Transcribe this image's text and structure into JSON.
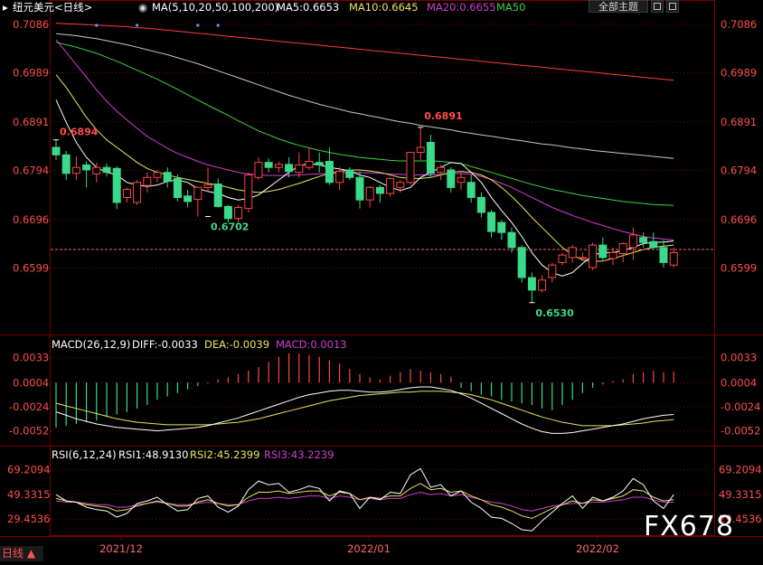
{
  "header": {
    "symbol": "纽元美元<日线>",
    "ma_title": "MA(5,10,20,50,100,200)",
    "ma5": "MA5:0.6653",
    "ma10": "MA10:0.6645",
    "ma20": "MA20:0.6655",
    "ma50": "MA50",
    "theme_button": "全部主题"
  },
  "colors": {
    "up": "#ff4545",
    "down": "#3bd98a",
    "ma5": "#ffffff",
    "ma10": "#e6e65a",
    "ma20": "#d23cd2",
    "ma50": "#3cd23c",
    "ma100": "#c8c8c8",
    "ma200": "#ff3c3c",
    "axis_text": "#ff4d4d",
    "grid": "#7a0000"
  },
  "price_axis_labels": [
    "0.7086",
    "0.6989",
    "0.6891",
    "0.6794",
    "0.6696",
    "0.6599"
  ],
  "annotations": {
    "high1": "0.6894",
    "low1": "0.6702",
    "high2": "0.6891",
    "low2": "0.6530"
  },
  "macd": {
    "title": "MACD(26,12,9)",
    "diff": "DIFF:-0.0033",
    "dea": "DEA:-0.0039",
    "macd": "MACD:0.0013",
    "axis_labels": [
      "0.0033",
      "0.0004",
      "-0.0024",
      "-0.0052"
    ]
  },
  "rsi": {
    "title": "RSI(6,12,24)",
    "rsi1": "RSI1:48.9130",
    "rsi2": "RSI2:45.2399",
    "rsi3": "RSI3:43.2239",
    "axis_labels": [
      "69.2094",
      "49.3315",
      "29.4536"
    ]
  },
  "x_labels": [
    "2021/12",
    "2022/01",
    "2022/02"
  ],
  "footer": {
    "timeframe": "日线 ▲",
    "watermark": "FX678"
  },
  "chart_data": {
    "type": "candlestick",
    "ylim": [
      0.647,
      0.71
    ],
    "current_price": 0.6636,
    "candles": [
      [
        0.684,
        0.6855,
        0.6815,
        0.6825
      ],
      [
        0.6825,
        0.6833,
        0.6775,
        0.6788
      ],
      [
        0.6788,
        0.6822,
        0.6775,
        0.68
      ],
      [
        0.6805,
        0.6812,
        0.676,
        0.6795
      ],
      [
        0.6787,
        0.681,
        0.677,
        0.68
      ],
      [
        0.68,
        0.6808,
        0.6782,
        0.679
      ],
      [
        0.6798,
        0.6802,
        0.6717,
        0.673
      ],
      [
        0.674,
        0.676,
        0.673,
        0.6756
      ],
      [
        0.673,
        0.6775,
        0.6725,
        0.677
      ],
      [
        0.6764,
        0.679,
        0.675,
        0.678
      ],
      [
        0.678,
        0.6795,
        0.677,
        0.679
      ],
      [
        0.679,
        0.68,
        0.676,
        0.6772
      ],
      [
        0.6778,
        0.6786,
        0.6732,
        0.674
      ],
      [
        0.6743,
        0.6755,
        0.672,
        0.6732
      ],
      [
        0.6736,
        0.6755,
        0.6702,
        0.676
      ],
      [
        0.676,
        0.68,
        0.675,
        0.6765
      ],
      [
        0.6767,
        0.6778,
        0.672,
        0.6722
      ],
      [
        0.6722,
        0.6725,
        0.669,
        0.6698
      ],
      [
        0.6698,
        0.6725,
        0.669,
        0.672
      ],
      [
        0.6718,
        0.679,
        0.671,
        0.6785
      ],
      [
        0.678,
        0.682,
        0.6775,
        0.681
      ],
      [
        0.681,
        0.6818,
        0.679,
        0.68
      ],
      [
        0.68,
        0.6812,
        0.679,
        0.6806
      ],
      [
        0.6806,
        0.682,
        0.678,
        0.6792
      ],
      [
        0.679,
        0.683,
        0.678,
        0.6805
      ],
      [
        0.68,
        0.684,
        0.6795,
        0.6812
      ],
      [
        0.681,
        0.683,
        0.679,
        0.6805
      ],
      [
        0.6812,
        0.684,
        0.6765,
        0.677
      ],
      [
        0.677,
        0.68,
        0.6755,
        0.6792
      ],
      [
        0.6795,
        0.68,
        0.6775,
        0.678
      ],
      [
        0.678,
        0.6792,
        0.6718,
        0.6735
      ],
      [
        0.6735,
        0.6763,
        0.672,
        0.676
      ],
      [
        0.676,
        0.6765,
        0.673,
        0.6748
      ],
      [
        0.6748,
        0.678,
        0.6742,
        0.6778
      ],
      [
        0.676,
        0.6775,
        0.675,
        0.677
      ],
      [
        0.677,
        0.683,
        0.6765,
        0.683
      ],
      [
        0.683,
        0.688,
        0.6815,
        0.684
      ],
      [
        0.685,
        0.6865,
        0.678,
        0.6788
      ],
      [
        0.679,
        0.6805,
        0.6775,
        0.68
      ],
      [
        0.6795,
        0.68,
        0.675,
        0.676
      ],
      [
        0.677,
        0.679,
        0.6755,
        0.678
      ],
      [
        0.677,
        0.6785,
        0.673,
        0.674
      ],
      [
        0.674,
        0.675,
        0.67,
        0.671
      ],
      [
        0.671,
        0.6715,
        0.666,
        0.6672
      ],
      [
        0.669,
        0.6695,
        0.6655,
        0.667
      ],
      [
        0.667,
        0.668,
        0.663,
        0.664
      ],
      [
        0.664,
        0.6645,
        0.657,
        0.658
      ],
      [
        0.658,
        0.659,
        0.653,
        0.6555
      ],
      [
        0.6555,
        0.6585,
        0.655,
        0.6575
      ],
      [
        0.658,
        0.661,
        0.657,
        0.6605
      ],
      [
        0.661,
        0.663,
        0.6605,
        0.6625
      ],
      [
        0.662,
        0.6645,
        0.661,
        0.664
      ],
      [
        0.662,
        0.663,
        0.662,
        0.662
      ],
      [
        0.66,
        0.665,
        0.6595,
        0.6645
      ],
      [
        0.6645,
        0.666,
        0.6615,
        0.662
      ],
      [
        0.6618,
        0.664,
        0.6605,
        0.663
      ],
      [
        0.6628,
        0.665,
        0.661,
        0.6648
      ],
      [
        0.664,
        0.668,
        0.6615,
        0.6665
      ],
      [
        0.666,
        0.667,
        0.664,
        0.665
      ],
      [
        0.6652,
        0.667,
        0.6638,
        0.664
      ],
      [
        0.664,
        0.6655,
        0.66,
        0.661
      ],
      [
        0.6605,
        0.664,
        0.66,
        0.663
      ]
    ],
    "ma_lines": {
      "ma5": [
        0.6935,
        0.689,
        0.685,
        0.682,
        0.68,
        0.679,
        0.6785,
        0.677,
        0.6765,
        0.6762,
        0.6765,
        0.6772,
        0.6775,
        0.677,
        0.6758,
        0.6752,
        0.6748,
        0.674,
        0.6735,
        0.6738,
        0.6745,
        0.676,
        0.6775,
        0.679,
        0.6803,
        0.6808,
        0.6805,
        0.68,
        0.6797,
        0.6793,
        0.6785,
        0.678,
        0.677,
        0.676,
        0.6754,
        0.676,
        0.678,
        0.679,
        0.68,
        0.681,
        0.6808,
        0.679,
        0.677,
        0.674,
        0.6714,
        0.669,
        0.6662,
        0.663,
        0.6605,
        0.659,
        0.6583,
        0.659,
        0.6608,
        0.6625,
        0.663,
        0.663,
        0.6634,
        0.664,
        0.6648,
        0.665,
        0.6651,
        0.6653
      ],
      "ma10": [
        0.6985,
        0.696,
        0.693,
        0.69,
        0.6875,
        0.6855,
        0.684,
        0.6825,
        0.681,
        0.6798,
        0.679,
        0.6785,
        0.678,
        0.6776,
        0.6772,
        0.6768,
        0.6765,
        0.676,
        0.6755,
        0.6752,
        0.675,
        0.6752,
        0.6756,
        0.6762,
        0.6768,
        0.6775,
        0.6782,
        0.6788,
        0.6792,
        0.6795,
        0.6795,
        0.6793,
        0.679,
        0.6785,
        0.678,
        0.6778,
        0.6778,
        0.678,
        0.6785,
        0.679,
        0.6792,
        0.679,
        0.6785,
        0.6775,
        0.676,
        0.6742,
        0.6722,
        0.67,
        0.668,
        0.666,
        0.664,
        0.6625,
        0.6615,
        0.6612,
        0.6613,
        0.6618,
        0.6624,
        0.663,
        0.6636,
        0.664,
        0.6643,
        0.6645
      ],
      "ma20": [
        0.7055,
        0.703,
        0.7005,
        0.698,
        0.6955,
        0.6932,
        0.6912,
        0.6895,
        0.6878,
        0.6862,
        0.685,
        0.6838,
        0.6828,
        0.682,
        0.6812,
        0.6805,
        0.68,
        0.6795,
        0.679,
        0.6787,
        0.6785,
        0.6784,
        0.6784,
        0.6784,
        0.6785,
        0.6786,
        0.6787,
        0.6788,
        0.6789,
        0.679,
        0.679,
        0.6789,
        0.6788,
        0.6787,
        0.6786,
        0.6785,
        0.6785,
        0.6785,
        0.6786,
        0.6787,
        0.6788,
        0.6786,
        0.6782,
        0.6776,
        0.6768,
        0.676,
        0.675,
        0.674,
        0.673,
        0.672,
        0.6712,
        0.6704,
        0.6697,
        0.669,
        0.6684,
        0.6678,
        0.6672,
        0.6667,
        0.6662,
        0.6659,
        0.6657,
        0.6655
      ],
      "ma50": [
        0.705,
        0.7045,
        0.704,
        0.7034,
        0.7028,
        0.702,
        0.7012,
        0.7003,
        0.6994,
        0.6985,
        0.6976,
        0.6966,
        0.6956,
        0.6945,
        0.6935,
        0.6924,
        0.6914,
        0.6904,
        0.6893,
        0.6883,
        0.6873,
        0.6865,
        0.6857,
        0.685,
        0.6844,
        0.6839,
        0.6834,
        0.683,
        0.6826,
        0.6823,
        0.682,
        0.6818,
        0.6816,
        0.6814,
        0.6813,
        0.6813,
        0.6813,
        0.6813,
        0.6812,
        0.681,
        0.6807,
        0.6802,
        0.6796,
        0.679,
        0.6784,
        0.6778,
        0.6772,
        0.6766,
        0.6761,
        0.6756,
        0.6752,
        0.6748,
        0.6744,
        0.6741,
        0.6738,
        0.6735,
        0.6732,
        0.673,
        0.6728,
        0.6726,
        0.6725,
        0.6724
      ],
      "ma100": [
        0.7067,
        0.7065,
        0.7063,
        0.706,
        0.7057,
        0.7053,
        0.7049,
        0.7045,
        0.704,
        0.7035,
        0.703,
        0.7025,
        0.7019,
        0.7013,
        0.7007,
        0.7,
        0.6993,
        0.6986,
        0.6979,
        0.6972,
        0.6965,
        0.6958,
        0.6951,
        0.6944,
        0.6938,
        0.6932,
        0.6926,
        0.6921,
        0.6916,
        0.6911,
        0.6907,
        0.6903,
        0.6899,
        0.6895,
        0.6891,
        0.6888,
        0.6884,
        0.6881,
        0.6878,
        0.6875,
        0.6871,
        0.6868,
        0.6865,
        0.6862,
        0.6859,
        0.6856,
        0.6853,
        0.685,
        0.6847,
        0.6845,
        0.6842,
        0.6839,
        0.6837,
        0.6834,
        0.6832,
        0.683,
        0.6828,
        0.6826,
        0.6824,
        0.6822,
        0.682,
        0.6818
      ],
      "ma200": [
        0.7088,
        0.7087,
        0.7086,
        0.7085,
        0.7084,
        0.7083,
        0.7082,
        0.7081,
        0.7079,
        0.7078,
        0.7076,
        0.7074,
        0.7072,
        0.707,
        0.7068,
        0.7066,
        0.7064,
        0.7062,
        0.706,
        0.7058,
        0.7056,
        0.7054,
        0.7052,
        0.705,
        0.7048,
        0.7046,
        0.7044,
        0.7042,
        0.704,
        0.7038,
        0.7036,
        0.7034,
        0.7032,
        0.703,
        0.7028,
        0.7026,
        0.7024,
        0.7022,
        0.702,
        0.7018,
        0.7016,
        0.7014,
        0.7012,
        0.701,
        0.7008,
        0.7006,
        0.7004,
        0.7002,
        0.7,
        0.6998,
        0.6996,
        0.6994,
        0.6992,
        0.699,
        0.6988,
        0.6986,
        0.6984,
        0.6982,
        0.698,
        0.6978,
        0.6976,
        0.6974
      ]
    },
    "macd_ylim": [
      -0.0064,
      0.004
    ],
    "macd_hist": [
      -0.0052,
      -0.005,
      -0.0048,
      -0.0046,
      -0.0044,
      -0.004,
      -0.0037,
      -0.0034,
      -0.003,
      -0.0026,
      -0.002,
      -0.0016,
      -0.0012,
      -0.0008,
      -0.0004,
      -0.0001,
      0.0004,
      0.0006,
      0.001,
      0.0014,
      0.0018,
      0.0024,
      0.003,
      0.0034,
      0.0034,
      0.0032,
      0.003,
      0.0026,
      0.0022,
      0.0016,
      0.001,
      0.0006,
      0.0004,
      0.0008,
      0.0012,
      0.0016,
      0.0014,
      0.0012,
      0.001,
      0.0007,
      -0.0006,
      -0.001,
      -0.0014,
      -0.0016,
      -0.002,
      -0.0022,
      -0.0024,
      -0.0026,
      -0.003,
      -0.0032,
      -0.0026,
      -0.002,
      -0.0012,
      -0.0006,
      -0.0002,
      0.0002,
      0.0004,
      0.001,
      0.0012,
      0.0014,
      0.0012,
      0.0013
    ],
    "macd_diff": [
      -0.003,
      -0.0034,
      -0.0038,
      -0.0041,
      -0.0044,
      -0.0046,
      -0.0048,
      -0.0049,
      -0.005,
      -0.0051,
      -0.0052,
      -0.0051,
      -0.005,
      -0.0049,
      -0.0048,
      -0.0046,
      -0.0043,
      -0.004,
      -0.0037,
      -0.0033,
      -0.0029,
      -0.0025,
      -0.0021,
      -0.0017,
      -0.0013,
      -0.001,
      -0.0008,
      -0.0006,
      -0.0005,
      -0.0005,
      -0.0006,
      -0.0007,
      -0.0007,
      -0.0006,
      -0.0004,
      -0.0002,
      -0.0001,
      -0.0001,
      -0.0003,
      -0.0005,
      -0.0009,
      -0.0014,
      -0.002,
      -0.0026,
      -0.0032,
      -0.0038,
      -0.0044,
      -0.0049,
      -0.0053,
      -0.0055,
      -0.0055,
      -0.0054,
      -0.0052,
      -0.005,
      -0.0048,
      -0.0046,
      -0.0044,
      -0.0041,
      -0.0038,
      -0.0036,
      -0.0034,
      -0.0033
    ],
    "macd_dea": [
      -0.002,
      -0.0023,
      -0.0026,
      -0.0029,
      -0.0032,
      -0.0035,
      -0.0038,
      -0.004,
      -0.0042,
      -0.0043,
      -0.0044,
      -0.0045,
      -0.0045,
      -0.0045,
      -0.0045,
      -0.0045,
      -0.0044,
      -0.0043,
      -0.0042,
      -0.004,
      -0.0038,
      -0.0035,
      -0.0032,
      -0.0029,
      -0.0026,
      -0.0023,
      -0.002,
      -0.0017,
      -0.0015,
      -0.0013,
      -0.0011,
      -0.001,
      -0.0009,
      -0.0008,
      -0.0007,
      -0.0007,
      -0.0006,
      -0.0006,
      -0.0006,
      -0.0007,
      -0.0008,
      -0.001,
      -0.0013,
      -0.0016,
      -0.002,
      -0.0024,
      -0.0028,
      -0.0032,
      -0.0036,
      -0.0039,
      -0.0042,
      -0.0044,
      -0.0046,
      -0.0046,
      -0.0046,
      -0.0046,
      -0.0045,
      -0.0044,
      -0.0043,
      -0.0041,
      -0.004,
      -0.0039
    ],
    "rsi_ylim": [
      18.0,
      76.0
    ],
    "rsi1": [
      49,
      44,
      43,
      39,
      37,
      36,
      31,
      34,
      42,
      44,
      47,
      41,
      36,
      37,
      46,
      48,
      39,
      35,
      40,
      53,
      60,
      57,
      58,
      51,
      53,
      56,
      54,
      44,
      52,
      50,
      38,
      47,
      45,
      51,
      50,
      65,
      70,
      55,
      57,
      48,
      52,
      43,
      38,
      31,
      30,
      26,
      21,
      20,
      28,
      35,
      42,
      48,
      38,
      47,
      44,
      47,
      52,
      62,
      57,
      44,
      38,
      49
    ],
    "rsi2": [
      46,
      44,
      43,
      41,
      40,
      39,
      36,
      37,
      40,
      42,
      44,
      42,
      40,
      40,
      43,
      45,
      42,
      40,
      41,
      47,
      51,
      51,
      52,
      50,
      51,
      52,
      52,
      48,
      51,
      50,
      45,
      47,
      46,
      48,
      48,
      54,
      58,
      53,
      54,
      51,
      52,
      48,
      45,
      41,
      39,
      36,
      32,
      30,
      34,
      38,
      41,
      44,
      42,
      45,
      44,
      46,
      48,
      53,
      52,
      47,
      44,
      45
    ],
    "rsi3": [
      44,
      43,
      43,
      42,
      41,
      41,
      39,
      39,
      41,
      42,
      43,
      42,
      41,
      41,
      42,
      43,
      42,
      41,
      41,
      44,
      46,
      46,
      47,
      46,
      47,
      48,
      48,
      46,
      48,
      47,
      45,
      46,
      45,
      46,
      46,
      49,
      51,
      49,
      50,
      48,
      49,
      47,
      45,
      43,
      42,
      40,
      37,
      36,
      38,
      40,
      41,
      42,
      42,
      43,
      43,
      44,
      45,
      47,
      47,
      45,
      43,
      43
    ]
  }
}
